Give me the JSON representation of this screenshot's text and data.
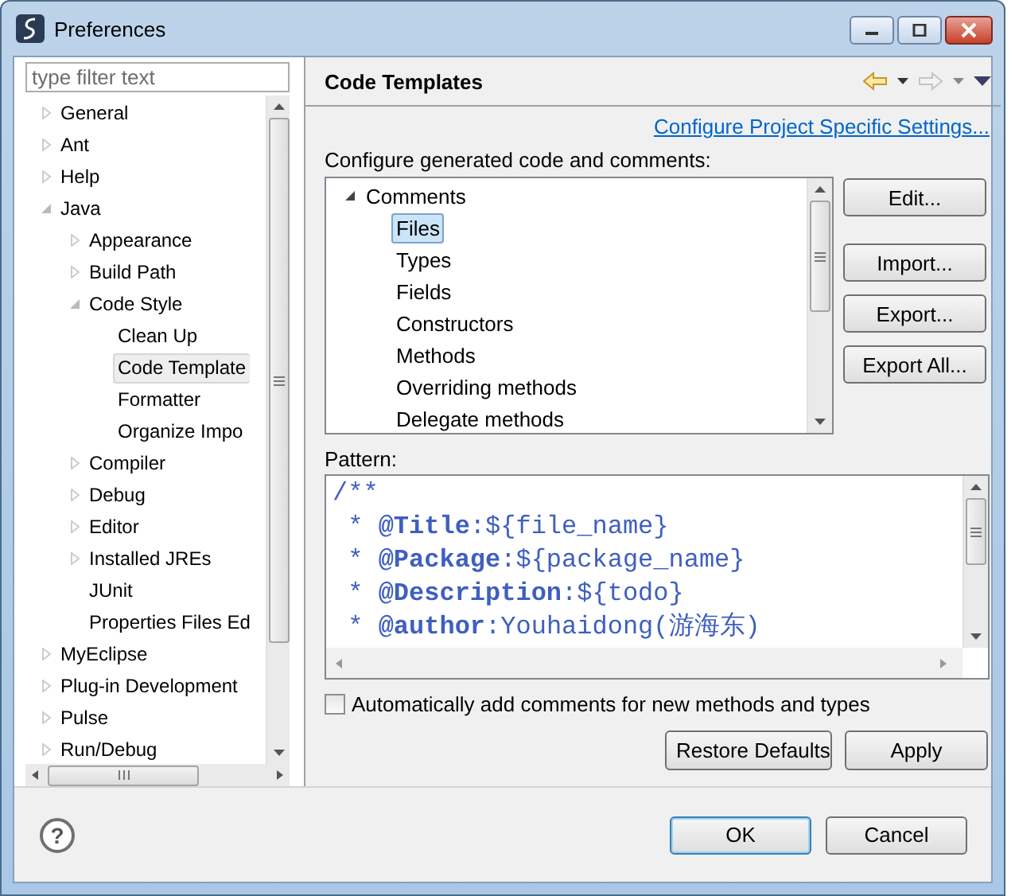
{
  "window": {
    "title": "Preferences"
  },
  "filter": {
    "placeholder": "type filter text"
  },
  "nav_tree": [
    {
      "label": "General",
      "expanded": false,
      "selected": false
    },
    {
      "label": "Ant",
      "expanded": false,
      "selected": false
    },
    {
      "label": "Help",
      "expanded": false,
      "selected": false
    },
    {
      "label": "Java",
      "expanded": true,
      "selected": false,
      "children": [
        {
          "label": "Appearance",
          "expanded": false,
          "selected": false
        },
        {
          "label": "Build Path",
          "expanded": false,
          "selected": false
        },
        {
          "label": "Code Style",
          "expanded": true,
          "selected": false,
          "children": [
            {
              "label": "Clean Up",
              "selected": false
            },
            {
              "label": "Code Template",
              "selected": true
            },
            {
              "label": "Formatter",
              "selected": false
            },
            {
              "label": "Organize Impo",
              "selected": false
            }
          ]
        },
        {
          "label": "Compiler",
          "expanded": false,
          "selected": false
        },
        {
          "label": "Debug",
          "expanded": false,
          "selected": false
        },
        {
          "label": "Editor",
          "expanded": false,
          "selected": false
        },
        {
          "label": "Installed JREs",
          "expanded": false,
          "selected": false
        },
        {
          "label": "JUnit",
          "selected": false
        },
        {
          "label": "Properties Files Ed",
          "selected": false
        }
      ]
    },
    {
      "label": "MyEclipse",
      "expanded": false,
      "selected": false
    },
    {
      "label": "Plug-in Development",
      "expanded": false,
      "selected": false
    },
    {
      "label": "Pulse",
      "expanded": false,
      "selected": false
    },
    {
      "label": "Run/Debug",
      "expanded": false,
      "selected": false
    }
  ],
  "page": {
    "title": "Code Templates",
    "link": "Configure Project Specific Settings...",
    "intro": "Configure generated code and comments:"
  },
  "template_tree": [
    {
      "label": "Comments",
      "expanded": true,
      "selected": false,
      "children": [
        {
          "label": "Files",
          "selected": true
        },
        {
          "label": "Types",
          "selected": false
        },
        {
          "label": "Fields",
          "selected": false
        },
        {
          "label": "Constructors",
          "selected": false
        },
        {
          "label": "Methods",
          "selected": false
        },
        {
          "label": "Overriding methods",
          "selected": false
        },
        {
          "label": "Delegate methods",
          "selected": false
        }
      ]
    }
  ],
  "side_buttons": [
    "Edit...",
    "Import...",
    "Export...",
    "Export All..."
  ],
  "pattern": {
    "label": "Pattern:",
    "lines": [
      "/**",
      " * **@Title**:${file_name}",
      " * **@Package**:${package_name}",
      " * **@Description**:${todo}",
      " * **@author**:Youhaidong(游海东)"
    ]
  },
  "auto_comments": {
    "label": "Automatically add comments for new methods and types",
    "checked": false
  },
  "page_buttons": [
    "Restore Defaults",
    "Apply"
  ],
  "help": "?",
  "dialog_buttons": [
    {
      "label": "OK",
      "default": true
    },
    {
      "label": "Cancel",
      "default": false
    }
  ]
}
